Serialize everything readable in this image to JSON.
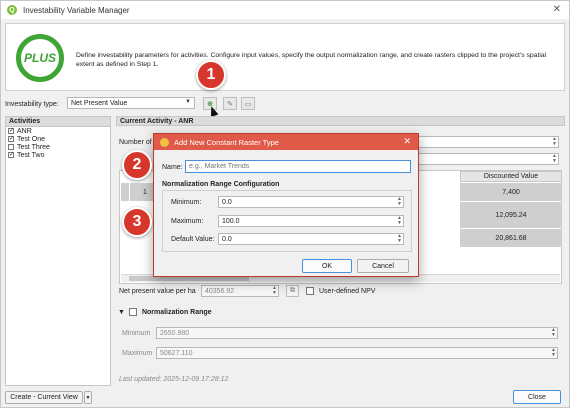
{
  "window": {
    "title": "Investability Variable Manager",
    "app_icon": "Q"
  },
  "banner": {
    "logo_text": "PLUS",
    "description": "Define investability parameters for activities. Configure input values, specify the output normalization range, and create rasters clipped to the project's spatial extent as defined in Step 1."
  },
  "toolbar": {
    "type_label": "Investability type:",
    "type_value": "Net Present Value"
  },
  "activities": {
    "header": "Activities",
    "items": [
      {
        "label": "ANR",
        "checked": true
      },
      {
        "label": "Test One",
        "checked": true
      },
      {
        "label": "Test Three",
        "checked": false
      },
      {
        "label": "Test Two",
        "checked": true
      }
    ]
  },
  "current": {
    "header": "Current Activity - ANR",
    "number_of_label": "Number of",
    "table": {
      "discounted_header": "Discounted Value",
      "row_number": "1",
      "discounted_values": [
        "7,400",
        "12,095.24",
        "20,861.68"
      ]
    },
    "npv_label": "Net present value per ha",
    "npv_value": "40356.92",
    "user_defined_label": "User-defined NPV"
  },
  "normalization": {
    "header": "Normalization Range",
    "min_label": "Minimum",
    "min_value": "2650.980",
    "max_label": "Maximum",
    "max_value": "50627.110"
  },
  "footer": {
    "last_updated": "Last updated: 2025-12-09 17:28:12",
    "create_button": "Create - Current View",
    "close_button": "Close"
  },
  "dialog": {
    "title": "Add New Constant Raster Type",
    "name_label": "Name:",
    "name_placeholder": "e.g., Market Trends",
    "group_title": "Normalization Range Configuration",
    "minimum_label": "Minimum:",
    "minimum_value": "0.0",
    "maximum_label": "Maximum:",
    "maximum_value": "100.0",
    "default_label": "Default Value:",
    "default_value": "0.0",
    "ok_button": "OK",
    "cancel_button": "Cancel"
  },
  "callouts": [
    "1",
    "2",
    "3"
  ],
  "colors": {
    "dialog_title": "#e05a4a",
    "badge": "#d6362c",
    "logo_green": "#3fa535"
  }
}
